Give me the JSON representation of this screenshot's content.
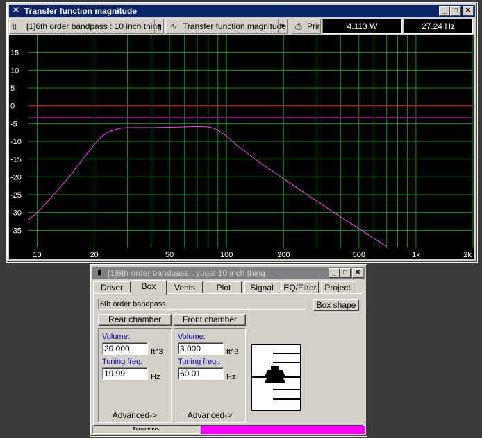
{
  "chart_window": {
    "title": "Transfer function magnitude",
    "design_select": "[1]6th order bandpass : 10 inch thing",
    "plot_select": "Transfer function magnitude",
    "print_label": "Print",
    "readout_power": "4.113 W",
    "readout_freq": "27.24 Hz"
  },
  "chart_data": {
    "type": "line",
    "title": "",
    "xlabel": "",
    "ylabel": "",
    "xscale": "log",
    "xlim": [
      9,
      2000
    ],
    "ylim": [
      -40,
      20
    ],
    "x_tick_labels": [
      "10",
      "20",
      "50",
      "100",
      "200",
      "500",
      "1k",
      "2k"
    ],
    "y_tick_labels": [
      "15",
      "10",
      "5",
      "0",
      "-5",
      "-10",
      "-15",
      "-20",
      "-25",
      "-30",
      "-35"
    ],
    "reference_lines": [
      {
        "y": 0,
        "color": "#ff0000"
      },
      {
        "y": -3.3,
        "color": "#a000a0"
      }
    ],
    "grid": true,
    "background": "#000000",
    "grid_color": "#00a000",
    "series": [
      {
        "color": "#ff40ff",
        "x": [
          9,
          10,
          12,
          15,
          18,
          20,
          22,
          24,
          26,
          28,
          30,
          35,
          40,
          50,
          60,
          70,
          80,
          85,
          90,
          100,
          110,
          130,
          150,
          200,
          300,
          400,
          500,
          600,
          700
        ],
        "y": [
          -32,
          -30,
          -25.5,
          -19.5,
          -14,
          -11,
          -8.5,
          -7.3,
          -6.6,
          -6.2,
          -6.1,
          -6.1,
          -6.1,
          -6.0,
          -5.9,
          -5.8,
          -5.9,
          -6.2,
          -6.8,
          -8.5,
          -10.5,
          -13.5,
          -16,
          -20.5,
          -26.8,
          -31.2,
          -34.5,
          -37.3,
          -39.5
        ]
      }
    ]
  },
  "params_window": {
    "title": "[1]6th order bandpass : yugal 10 inch thing",
    "tabs": [
      "Driver",
      "Box",
      "Vents",
      "Plot",
      "Signal",
      "EQ/Filter",
      "Project"
    ],
    "box_type": "6th order bandpass",
    "box_shape_button": "Box shape",
    "rear": {
      "button": "Rear chamber",
      "volume_label": "Volume:",
      "volume_value": "20.000",
      "volume_unit": "ft^3",
      "tuning_label": "Tuning freq.",
      "tuning_value": "19.99",
      "tuning_unit": "Hz",
      "advanced": "Advanced->"
    },
    "front": {
      "button": "Front chamber",
      "volume_label": "Volume:",
      "volume_value": "3.000",
      "volume_unit": "ft^3",
      "tuning_label": "Tuning freq.:",
      "tuning_value": "60.01",
      "tuning_unit": "Hz",
      "advanced": "Advanced->"
    },
    "status_label": "Parameters",
    "status_color": "#ff00ff"
  },
  "icons": {
    "chart_window": "plot-icon",
    "params_window": "document-icon",
    "plot_select": "wave-icon",
    "print": "printer-icon"
  }
}
